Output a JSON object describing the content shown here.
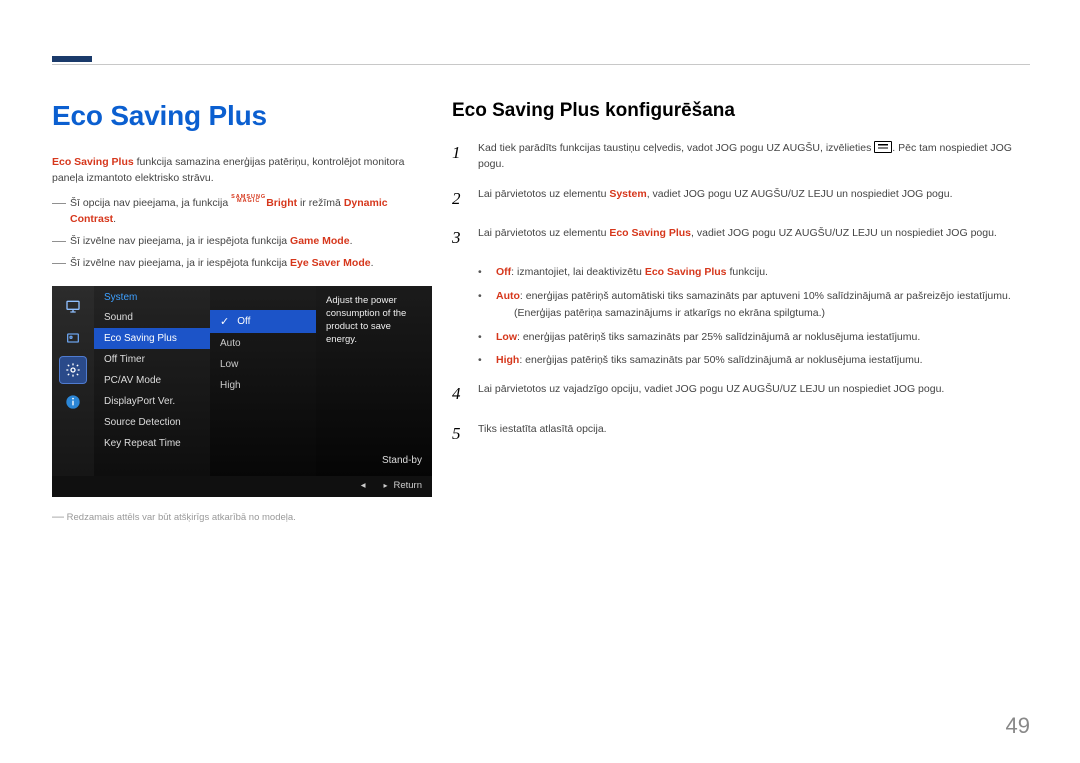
{
  "page_number": "49",
  "left": {
    "h1": "Eco Saving Plus",
    "intro": {
      "bold": "Eco Saving Plus",
      "rest": " funkcija samazina enerģijas patēriņu, kontrolējot monitora paneļa izmantoto elektrisko strāvu."
    },
    "notes": [
      {
        "pre": "Šī opcija nav pieejama, ja funkcija ",
        "magic_top": "SAMSUNG",
        "magic_bottom": "MAGIC",
        "mid": "Bright",
        "mid2": " ir režīmā ",
        "red": "Dynamic Contrast",
        "period": "."
      },
      {
        "pre": "Šī izvēlne nav pieejama, ja ir iespējota funkcija ",
        "red": "Game Mode",
        "period": "."
      },
      {
        "pre": "Šī izvēlne nav pieejama, ja ir iespējota funkcija ",
        "red": "Eye Saver Mode",
        "period": "."
      }
    ],
    "menu": {
      "header": "System",
      "items": [
        "Sound",
        "Eco Saving Plus",
        "Off Timer",
        "PC/AV Mode",
        "DisplayPort Ver.",
        "Source Detection",
        "Key Repeat Time"
      ],
      "opts": [
        "Off",
        "Auto",
        "Low",
        "High"
      ],
      "desc": "Adjust the power consumption of the product to save energy.",
      "standby": "Stand-by",
      "return": "Return"
    },
    "img_note": "Redzamais attēls var būt atšķirīgs atkarībā no modeļa."
  },
  "right": {
    "h2": "Eco Saving Plus konfigurēšana",
    "steps": [
      {
        "n": "1",
        "a": "Kad tiek parādīts funkcijas taustiņu ceļvedis, vadot JOG pogu UZ AUGŠU, izvēlieties ",
        "c": ". Pēc tam nospiediet JOG pogu."
      },
      {
        "n": "2",
        "a": "Lai pārvietotos uz elementu ",
        "b": "System",
        "c": ", vadiet JOG pogu UZ AUGŠU/UZ LEJU un nospiediet JOG pogu."
      },
      {
        "n": "3",
        "a": "Lai pārvietotos uz elementu ",
        "b": "Eco Saving Plus",
        "c": ", vadiet JOG pogu UZ AUGŠU/UZ LEJU un nospiediet JOG pogu."
      },
      {
        "n": "4",
        "t": "Lai pārvietotos uz vajadzīgo opciju, vadiet JOG pogu UZ AUGŠU/UZ LEJU un nospiediet JOG pogu."
      },
      {
        "n": "5",
        "t": "Tiks iestatīta atlasītā opcija."
      }
    ],
    "bullets": [
      {
        "b": "Off",
        "rest": ": izmantojiet, lai deaktivizētu ",
        "b2": "Eco Saving Plus",
        "rest2": " funkciju."
      },
      {
        "b": "Auto",
        "rest": ": enerģijas patēriņš automātiski tiks samazināts par aptuveni 10% salīdzinājumā ar pašreizējo iestatījumu.",
        "sub": "(Enerģijas patēriņa samazinājums ir atkarīgs no ekrāna spilgtuma.)"
      },
      {
        "b": "Low",
        "rest": ": enerģijas patēriņš tiks samazināts par 25% salīdzinājumā ar noklusējuma iestatījumu."
      },
      {
        "b": "High",
        "rest": ": enerģijas patēriņš tiks samazināts par 50% salīdzinājumā ar noklusējuma iestatījumu."
      }
    ]
  }
}
